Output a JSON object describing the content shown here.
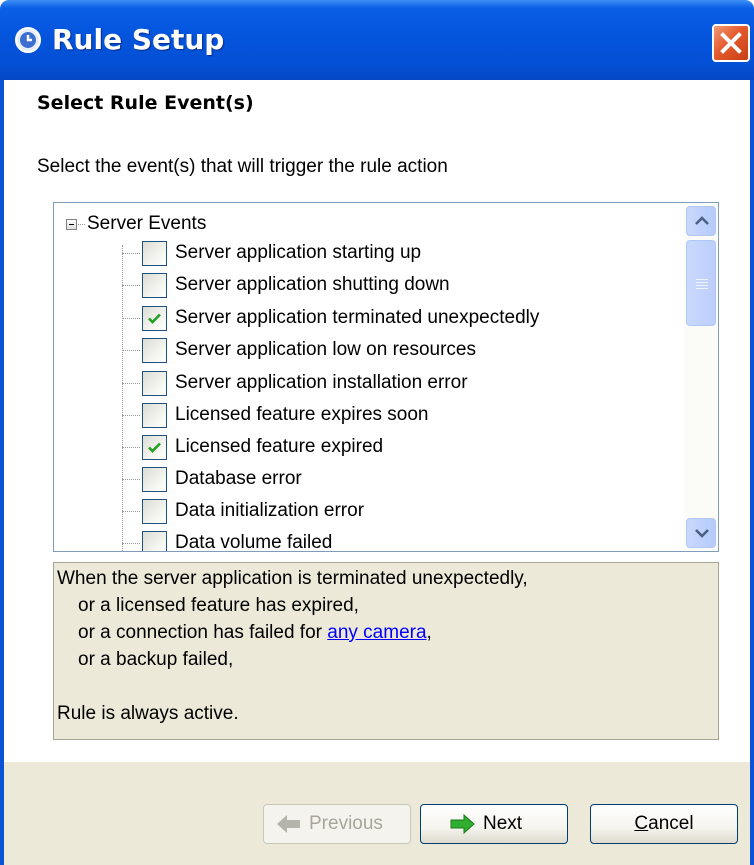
{
  "window": {
    "title": "Rule Setup",
    "icons": {
      "app": "rule-setup-icon",
      "close": "close-icon"
    }
  },
  "page": {
    "heading": "Select Rule Event(s)",
    "instruction": "Select the event(s) that will trigger the rule action"
  },
  "tree": {
    "root_label": "Server Events",
    "root_expanded": true,
    "items": [
      {
        "label": "Server application starting up",
        "checked": false
      },
      {
        "label": "Server application shutting down",
        "checked": false
      },
      {
        "label": "Server application terminated unexpectedly",
        "checked": true
      },
      {
        "label": "Server application low on resources",
        "checked": false
      },
      {
        "label": "Server application installation error",
        "checked": false
      },
      {
        "label": "Licensed feature expires soon",
        "checked": false
      },
      {
        "label": "Licensed feature expired",
        "checked": true
      },
      {
        "label": "Database error",
        "checked": false
      },
      {
        "label": "Data initialization error",
        "checked": false
      },
      {
        "label": "Data volume failed",
        "checked": false
      }
    ]
  },
  "description": {
    "line1": "When the server application is terminated unexpectedly,",
    "line2": "or a licensed feature has expired,",
    "line3_prefix": "or a connection has failed for ",
    "line3_link": "any camera",
    "line3_suffix": ",",
    "line4": "or a backup failed,",
    "line5": "Rule is always active."
  },
  "buttons": {
    "previous": "Previous",
    "next": "Next",
    "cancel": "Cancel"
  },
  "colors": {
    "titlebar": "#0454dc",
    "close": "#e45a2c",
    "panel": "#ece9d8",
    "check": "#21a121",
    "link": "#0000ff",
    "next_arrow": "#2fae2f"
  }
}
